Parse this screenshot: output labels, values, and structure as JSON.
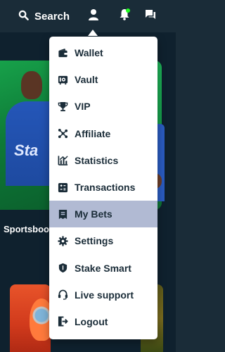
{
  "header": {
    "search_label": "Search",
    "icons": [
      "search-icon",
      "user-icon",
      "notification-bell-icon",
      "chat-icon"
    ],
    "notification_dot_color": "#1fff20"
  },
  "background": {
    "card_label": "Sportsboo",
    "shirt_text": "Sta"
  },
  "menu": {
    "items": [
      {
        "label": "Wallet",
        "icon": "wallet-icon"
      },
      {
        "label": "Vault",
        "icon": "vault-icon"
      },
      {
        "label": "VIP",
        "icon": "trophy-icon"
      },
      {
        "label": "Affiliate",
        "icon": "affiliate-icon"
      },
      {
        "label": "Statistics",
        "icon": "statistics-icon"
      },
      {
        "label": "Transactions",
        "icon": "transactions-icon"
      },
      {
        "label": "My Bets",
        "icon": "bets-icon",
        "active": true
      },
      {
        "label": "Settings",
        "icon": "gear-icon"
      },
      {
        "label": "Stake Smart",
        "icon": "shield-icon"
      },
      {
        "label": "Live support",
        "icon": "headset-icon"
      },
      {
        "label": "Logout",
        "icon": "logout-icon"
      }
    ]
  },
  "colors": {
    "topbar": "#1a2c38",
    "menu_text": "#1a2c38",
    "active_item": "#b1bad3"
  }
}
